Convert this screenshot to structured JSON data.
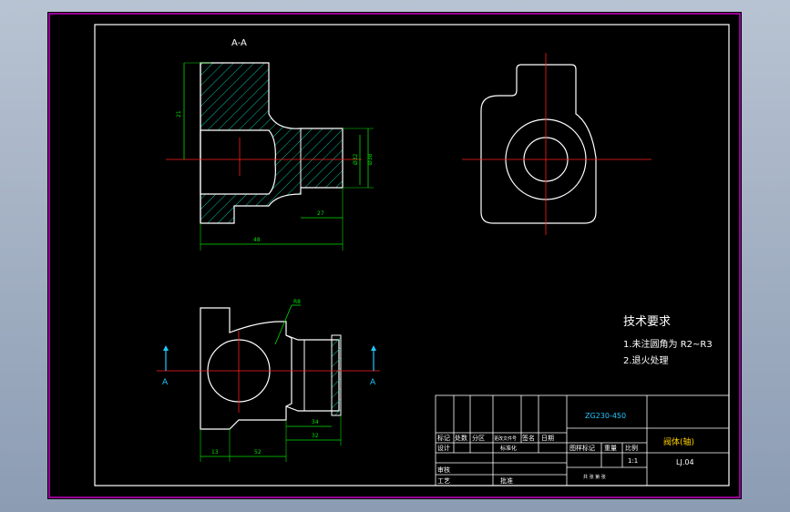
{
  "section_label": "A-A",
  "section_marks": {
    "left": "A",
    "right": "A"
  },
  "dims": {
    "top_left_height": "21",
    "right_d1": "Ø32",
    "right_d2": "Ø38",
    "bottom_27": "27",
    "overall_48": "48",
    "radius_label": "R8",
    "bv_34": "34",
    "bv_32": "32",
    "bv_13": "13",
    "bv_52": "52"
  },
  "tech": {
    "title": "技术要求",
    "line1": "1.未注圆角为 R2~R3",
    "line2": "2.退火处理"
  },
  "title_block": {
    "material": "ZG230-450",
    "part_name": "阀体(轴)",
    "drawing_no": "LJ.04",
    "scale": "1:1",
    "header_cells": [
      "标记",
      "处数",
      "分区",
      "更改文件号",
      "签名",
      "日期"
    ],
    "design": "设计",
    "standardize": "标准化",
    "stage_mark": "图样标记",
    "weight": "重量",
    "ratio": "比例",
    "review": "审核",
    "process": "工艺",
    "approve": "批准",
    "sheet": "共  张  第  张"
  },
  "colors": {
    "frame": "#c800c8",
    "lines": "#ffffff",
    "center": "#ff2020",
    "dim": "#00e000",
    "hatch": "#00c0a0",
    "cyan": "#20c8ff"
  }
}
